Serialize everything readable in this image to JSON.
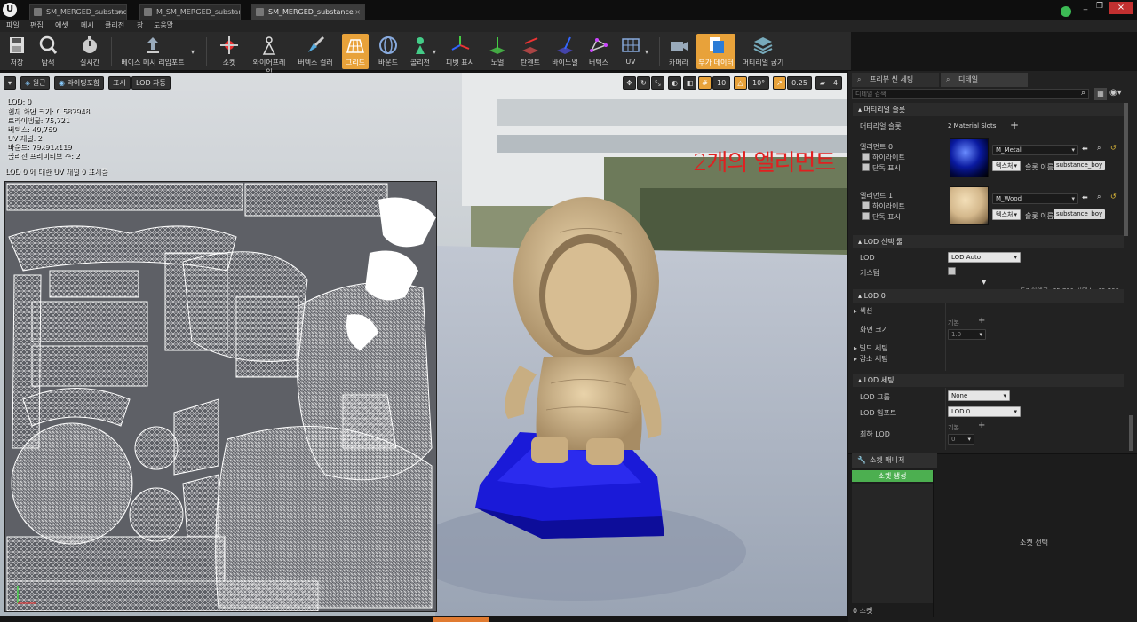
{
  "window": {
    "tabs": [
      {
        "label": "SM_MERGED_substance",
        "close": "×"
      },
      {
        "label": "M_SM_MERGED_substan",
        "close": "×"
      },
      {
        "label": "SM_MERGED_substance",
        "close": "×"
      }
    ],
    "controls": [
      "_",
      "❐",
      "×"
    ]
  },
  "menu": [
    "파일",
    "편집",
    "에셋",
    "메시",
    "클리전",
    "창",
    "도움말"
  ],
  "toolbar": {
    "buttons": [
      {
        "label": "저장",
        "icon": "save-icon"
      },
      {
        "label": "탐색",
        "icon": "browse-icon"
      },
      {
        "label": "실시간",
        "icon": "realtime-icon"
      },
      {
        "label": "베이스 메시 리임포트",
        "icon": "reimport-icon"
      },
      {
        "label": "소켓",
        "icon": "socket-icon"
      },
      {
        "label": "와이어프레임",
        "icon": "wireframe-icon"
      },
      {
        "label": "버텍스 컬러",
        "icon": "vertex-color-icon"
      },
      {
        "label": "그리드",
        "icon": "grid-icon"
      },
      {
        "label": "바운드",
        "icon": "bounds-icon"
      },
      {
        "label": "콜리전",
        "icon": "collision-icon"
      },
      {
        "label": "피벗 표시",
        "icon": "pivot-icon"
      },
      {
        "label": "노멀",
        "icon": "normals-icon"
      },
      {
        "label": "탄젠트",
        "icon": "tangents-icon"
      },
      {
        "label": "바이노멀",
        "icon": "binormals-icon"
      },
      {
        "label": "버텍스",
        "icon": "vertices-icon"
      },
      {
        "label": "UV",
        "icon": "uv-icon"
      },
      {
        "label": "카메라",
        "icon": "camera-icon"
      },
      {
        "label": "부가 데이터",
        "icon": "additional-data-icon"
      },
      {
        "label": "머티리얼 굽기",
        "icon": "bake-material-icon"
      }
    ],
    "selected": [
      "그리드",
      "부가 데이터"
    ]
  },
  "viewport": {
    "options": [
      "원근",
      "라이팅포함",
      "표시",
      "LOD 자동"
    ],
    "right_controls": {
      "grid_snap": "10",
      "rot_snap": "10°",
      "scale_snap": "0.25",
      "cam_speed": "4"
    },
    "stats": [
      "LOD: 0",
      "현재 화면 크기: 0.582948",
      "트라이앵글: 75,721",
      "버텍스: 40,760",
      "UV 채널: 2",
      "바운드: 79x91x119",
      "콜리전 프리미티브 수: 2"
    ],
    "uv_label": "LOD 0 에 대한 UV 채널 0 표시중"
  },
  "right_panel": {
    "tabs": [
      "프리뷰 씬 세팅",
      "디테일"
    ],
    "search_placeholder": "디테일 검색",
    "material_slots": {
      "header": "머티리얼 슬롯",
      "label": "머티리얼 슬롯",
      "count": "2 Material Slots",
      "add": "+",
      "elements": [
        {
          "name": "엘리먼트 0",
          "material": "M_Metal",
          "highlight": "하이라이트",
          "isolate": "단독 표시",
          "texture_btn": "텍스처",
          "slot_label": "슬롯 이름",
          "slot_name": "substance_boy"
        },
        {
          "name": "엘리먼트 1",
          "material": "M_Wood",
          "highlight": "하이라이트",
          "isolate": "단독 표시",
          "texture_btn": "텍스처",
          "slot_label": "슬롯 이름",
          "slot_name": "substance_boy"
        }
      ],
      "annotation": "2개의 엘리먼트"
    },
    "lod_picker": {
      "header": "LOD 선택 툴",
      "lod_label": "LOD",
      "lod_value": "LOD Auto",
      "custom_label": "커스텀",
      "tri_info": "트라이앵글: 75,721    버텍스: 40,760"
    },
    "lod0": {
      "header": "LOD 0",
      "sections": "섹션",
      "screen_size": "화면 크기",
      "default": "기본",
      "screen_value": "1.0",
      "build": "빌드 세팅",
      "reduce": "감소 세팅"
    },
    "lod_settings": {
      "header": "LOD 세팅",
      "group_label": "LOD 그룹",
      "group_value": "None",
      "import_label": "LOD 임포트",
      "import_value": "LOD 0",
      "min_label": "최하 LOD",
      "default": "기본",
      "min_value": "0"
    },
    "socket_manager": {
      "tab": "소켓 매니저",
      "create": "소켓 생성",
      "select": "소켓 선택",
      "count": "0 소켓"
    }
  },
  "colors": {
    "accent": "#e8a23a",
    "socket_create": "#4caf50",
    "annotation": "#e02020"
  }
}
